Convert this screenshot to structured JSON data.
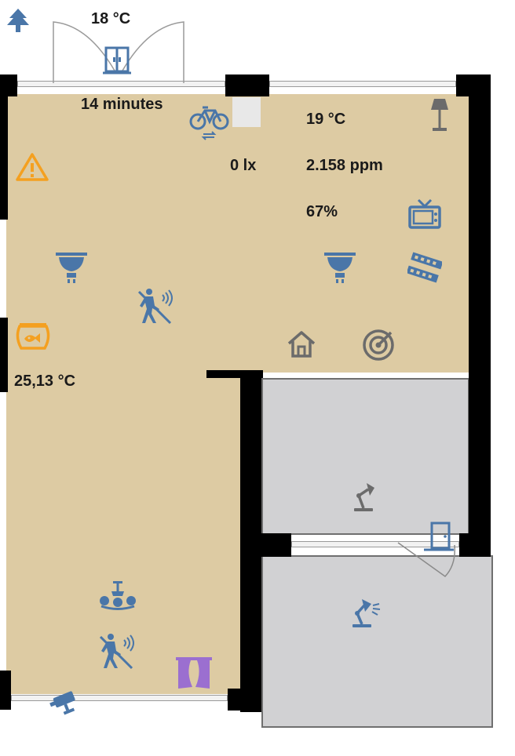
{
  "labels": {
    "outside_temp": "18 °C",
    "timer": "14 minutes",
    "room_temp": "19 °C",
    "illuminance": "0 lx",
    "co2": "2.158 ppm",
    "humidity": "67%",
    "aquarium_temp": "25,13 °C"
  },
  "colors": {
    "icon_blue": "#4a76a8",
    "warning_orange": "#f4a020",
    "grey_icon": "#6b6b6b",
    "curtain_purple": "#9b6fd0",
    "floor_beige": "#ddcba3",
    "floor_grey": "#d1d1d3"
  },
  "icons": [
    "tree-icon",
    "door-icon",
    "bicycle-icon",
    "floor-lamp-icon",
    "warning-icon",
    "tv-icon",
    "ceiling-light-icon",
    "film-icon",
    "motion-sensor-icon",
    "aquarium-icon",
    "home-icon",
    "radar-icon",
    "desk-lamp-icon",
    "chandelier-icon",
    "curtains-icon",
    "camera-icon"
  ]
}
